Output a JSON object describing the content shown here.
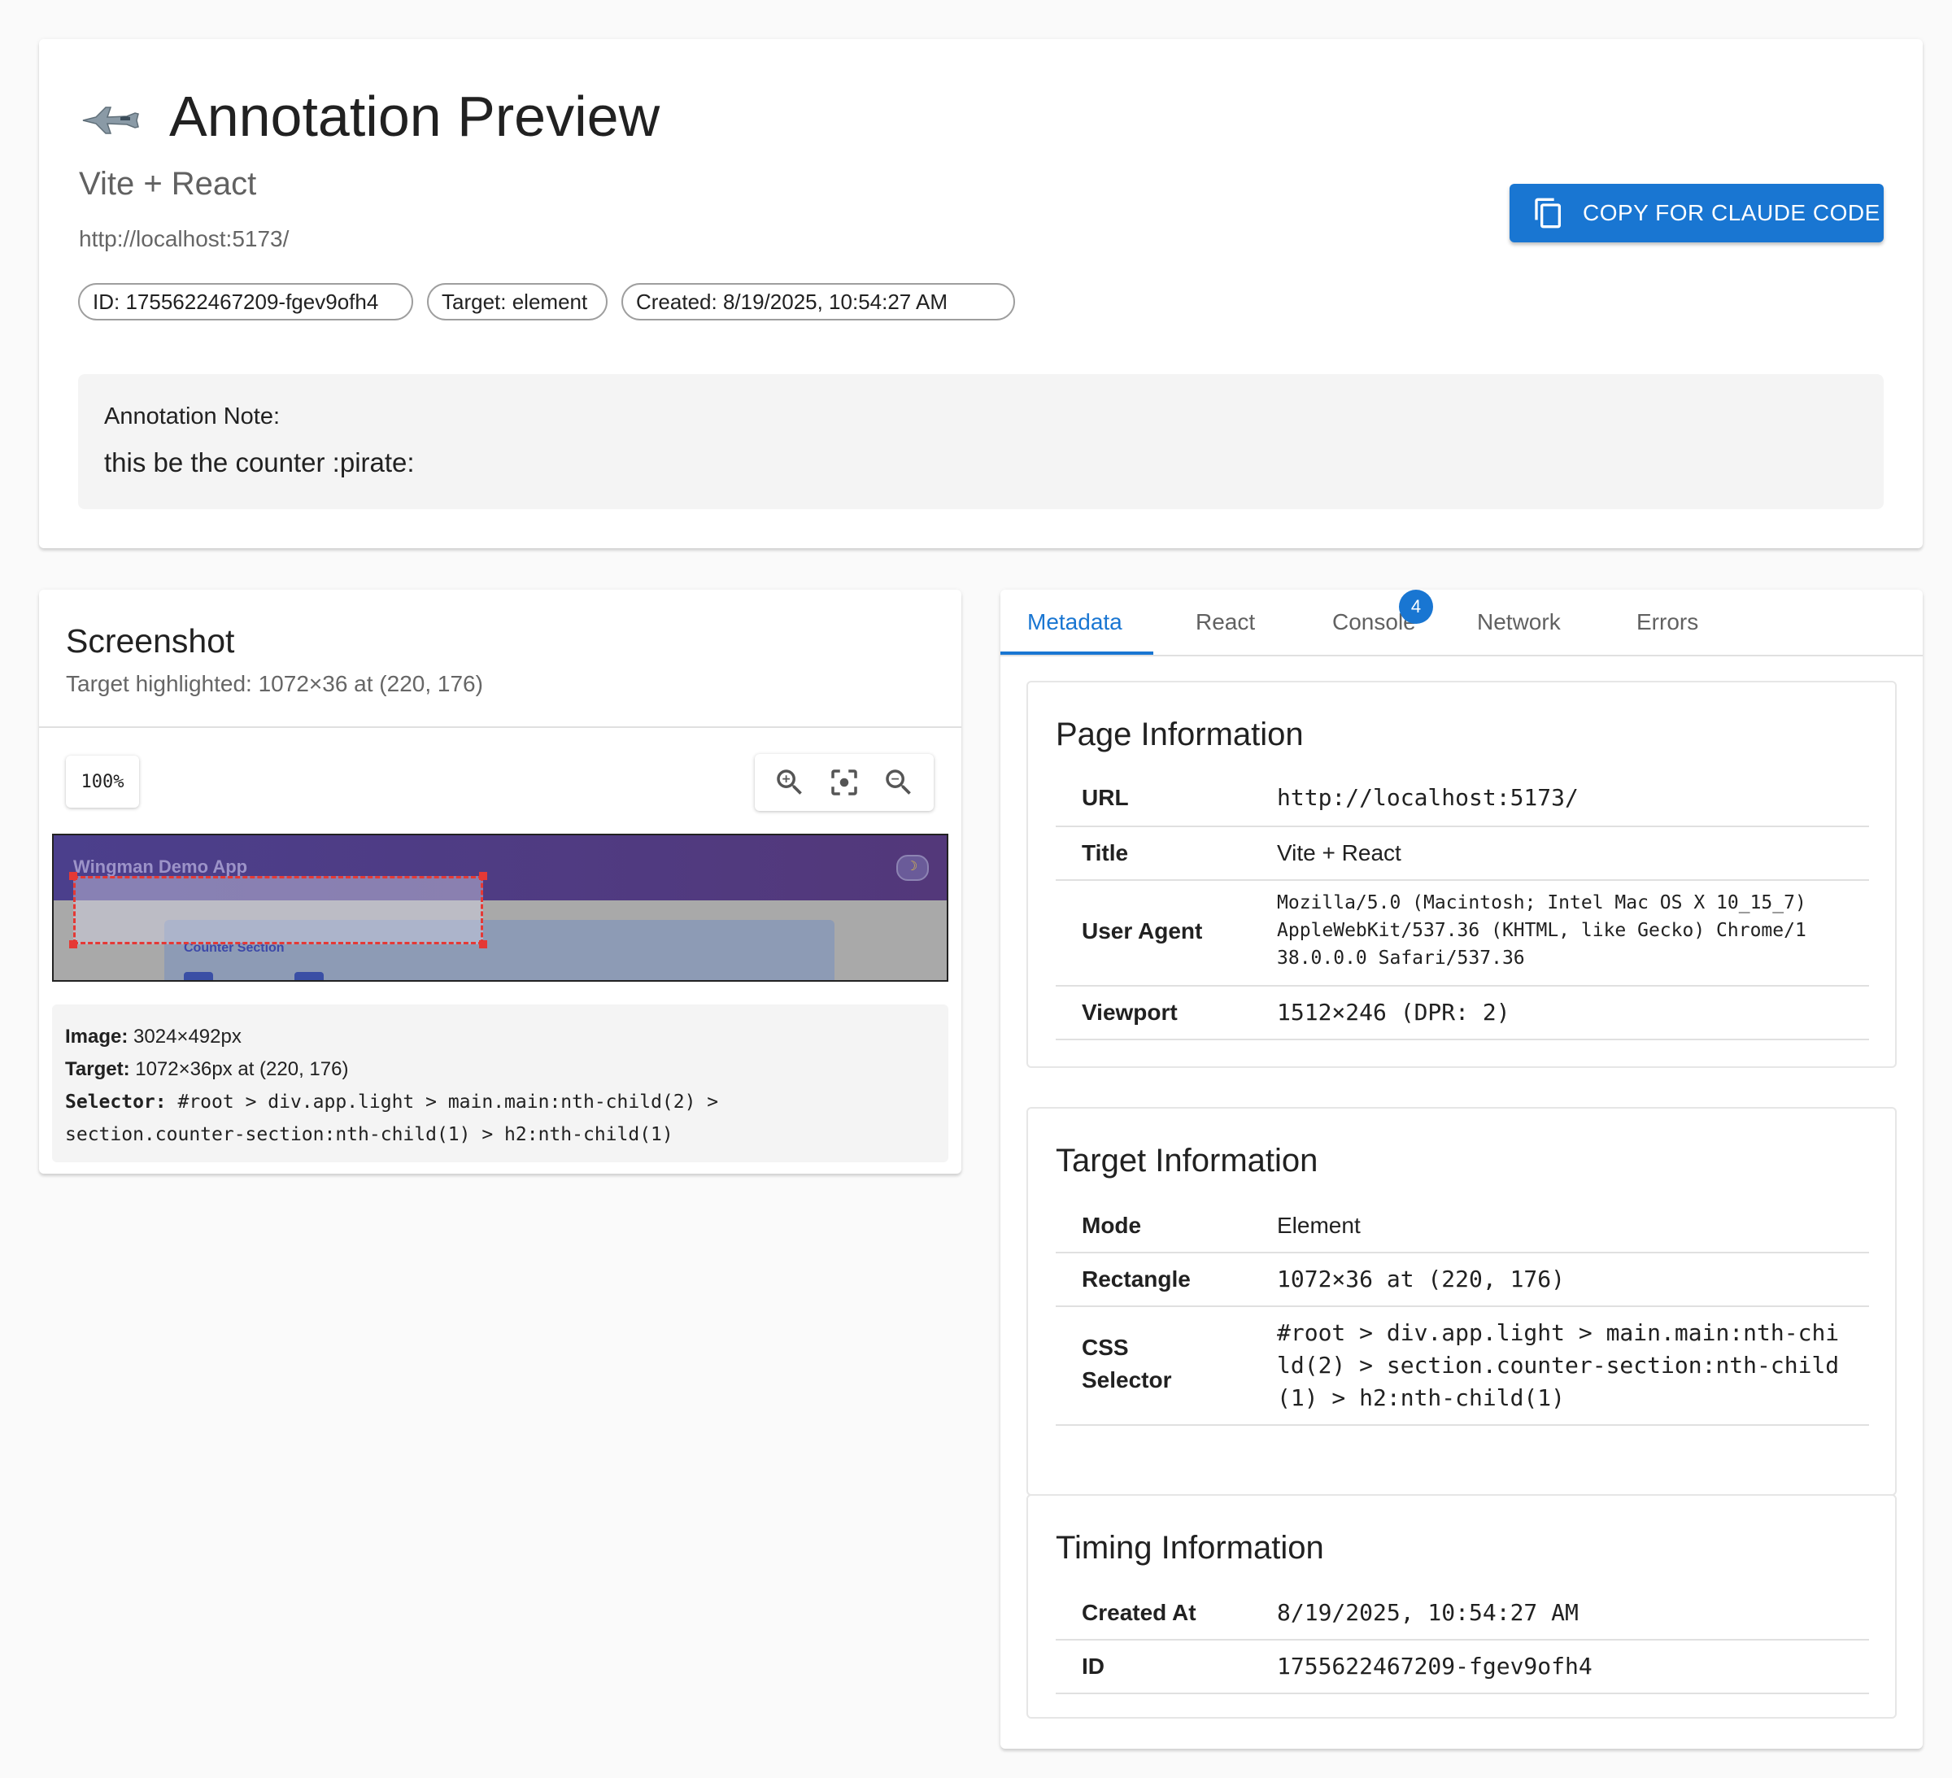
{
  "header": {
    "title": "Annotation Preview",
    "subtitle": "Vite + React",
    "url": "http://localhost:5173/",
    "chips": {
      "id": "ID: 1755622467209-fgev9ofh4",
      "target": "Target: element",
      "created": "Created: 8/19/2025, 10:54:27 AM"
    },
    "copy_button_label": "COPY FOR CLAUDE CODE",
    "note_label": "Annotation Note:",
    "note_text": "this be the counter :pirate:"
  },
  "screenshot": {
    "title": "Screenshot",
    "subtitle": "Target highlighted: 1072×36 at (220, 176)",
    "zoom_level": "100%",
    "preview": {
      "app_title": "Wingman Demo App",
      "section_title": "Counter Section"
    },
    "details": {
      "image_label": "Image:",
      "image_value": "3024×492px",
      "target_label": "Target:",
      "target_value": "1072×36px at (220, 176)",
      "selector_label": "Selector:",
      "selector_value": "#root > div.app.light > main.main:nth-child(2) >",
      "selector_value_2": "section.counter-section:nth-child(1) > h2:nth-child(1)"
    }
  },
  "tabs": {
    "items": [
      "Metadata",
      "React",
      "Console",
      "Network",
      "Errors"
    ],
    "active": "Metadata",
    "console_badge": "4"
  },
  "page_info": {
    "title": "Page Information",
    "rows": [
      {
        "key": "URL",
        "value": "http://localhost:5173/"
      },
      {
        "key": "Title",
        "value": "Vite + React"
      },
      {
        "key": "User Agent",
        "value_lines": [
          "Mozilla/5.0 (Macintosh; Intel Mac OS X 10_15_7)",
          "AppleWebKit/537.36 (KHTML, like Gecko) Chrome/1",
          "38.0.0.0 Safari/537.36"
        ]
      },
      {
        "key": "Viewport",
        "value": "1512×246 (DPR: 2)"
      }
    ]
  },
  "target_info": {
    "title": "Target Information",
    "rows": [
      {
        "key": "Mode",
        "value": "Element"
      },
      {
        "key": "Rectangle",
        "value": "1072×36 at (220, 176)"
      },
      {
        "key_lines": [
          "CSS",
          "Selector"
        ],
        "value_lines": [
          "#root > div.app.light > main.main:nth-chi",
          "ld(2) > section.counter-section:nth-child",
          "(1) > h2:nth-child(1)"
        ]
      }
    ]
  },
  "timing_info": {
    "title": "Timing Information",
    "rows": [
      {
        "key": "Created At",
        "value": "8/19/2025, 10:54:27 AM"
      },
      {
        "key": "ID",
        "value": "1755622467209-fgev9ofh4"
      }
    ]
  },
  "colors": {
    "accent": "#1976d2",
    "highlight": "#e53935",
    "background": "#fafafa"
  },
  "icons": {
    "logo": "fighter-jet-icon",
    "copy": "copy-icon",
    "zoom_in": "zoom-in-icon",
    "center_focus": "center-focus-icon",
    "zoom_out": "zoom-out-icon"
  }
}
